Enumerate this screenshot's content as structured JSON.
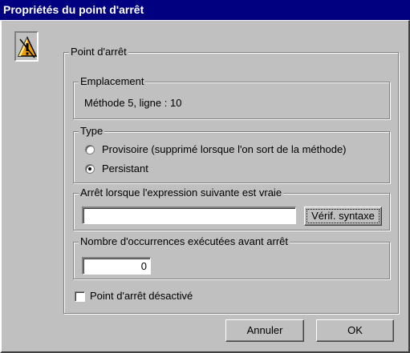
{
  "window": {
    "title": "Propriétés du point d'arrêt"
  },
  "icon": {
    "name": "warning-icon",
    "color": "#f0a000"
  },
  "main_group": {
    "legend": "Point d'arrêt"
  },
  "location": {
    "legend": "Emplacement",
    "value": "Méthode 5, ligne : 10"
  },
  "type": {
    "legend": "Type",
    "options": [
      {
        "label": "Provisoire (supprimé lorsque l'on sort de la méthode)",
        "checked": false
      },
      {
        "label": "Persistant",
        "checked": true
      }
    ]
  },
  "condition": {
    "legend": "Arrêt lorsque l'expression suivante est vraie",
    "value": "",
    "check_button": "Vérif. syntaxe"
  },
  "occurrences": {
    "legend": "Nombre d'occurrences exécutées avant arrêt",
    "value": "0"
  },
  "disabled_checkbox": {
    "label": "Point d'arrêt désactivé",
    "checked": false
  },
  "buttons": {
    "cancel": "Annuler",
    "ok": "OK"
  }
}
